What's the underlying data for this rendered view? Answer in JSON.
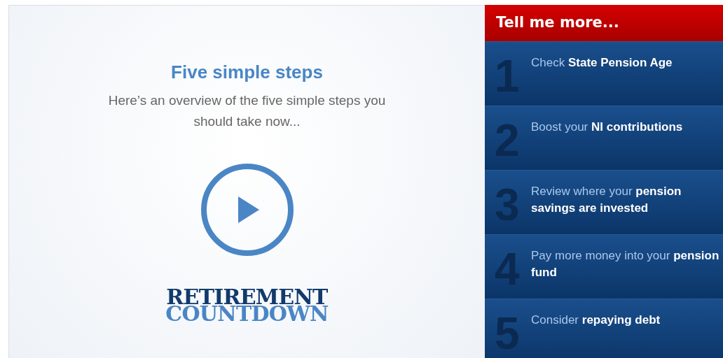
{
  "video_panel": {
    "title": "Five simple steps",
    "subtitle": "Here’s an overview of the five simple steps you should take now...",
    "logo": {
      "line_1": "RETIREMENT",
      "line_2": "COUNTDOWN"
    }
  },
  "steps_panel": {
    "heading": "Tell me more...",
    "steps": [
      {
        "number": "1",
        "text": "Check **State Pension Age**"
      },
      {
        "number": "2",
        "text": "Boost your **NI contributions**"
      },
      {
        "number": "3",
        "text": "Review where your **pension savings are invested**"
      },
      {
        "number": "4",
        "text": "Pay more money into your **pension fund**"
      },
      {
        "number": "5",
        "text": "Consider **repaying debt**"
      }
    ]
  }
}
